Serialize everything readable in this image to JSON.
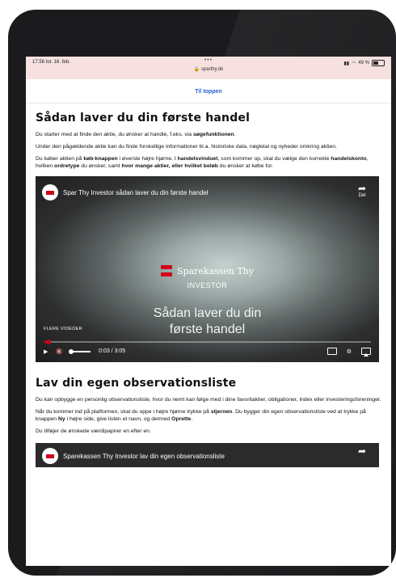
{
  "status": {
    "time_date": "17.56 tor. 16. feb.",
    "dots": "•••",
    "url": "sparthy.dk",
    "battery": "49 %"
  },
  "nav": {
    "to_top": "Til toppen"
  },
  "section1": {
    "heading": "Sådan laver du din første handel",
    "p1_a": "Du starter med at finde den aktie, du ønsker at handle, f.eks. via ",
    "p1_b": "søgefunktionen",
    "p1_c": ".",
    "p2": "Under den pågældende aktie kan du finde forskellige informationer bl.a. historiske data, nøgletal og nyheder omkring aktien.",
    "p3_a": "Du køber aktien på ",
    "p3_b": "køb-knappen",
    "p3_c": " i øverste højre hjørne. I ",
    "p3_d": "handelsvinduet",
    "p3_e": ", som kommer op, skal du vælge den korrekte ",
    "p3_f": "handelskonto",
    "p3_g": ", hvilken ",
    "p3_h": "ordretype",
    "p3_i": " du ønsker, samt ",
    "p3_j": "hvor mange aktier, eller hvilket beløb",
    "p3_k": " du ønsker at købe for."
  },
  "video1": {
    "title": "Spar Thy Investor sådan laver du din første handel",
    "share_label": "Del",
    "brand_name": "Sparekassen Thy",
    "brand_sub": "INVESTOR",
    "overlay_title_line1": "Sådan laver du din",
    "overlay_title_line2": "første handel",
    "more_videos": "FLERE VIDEOER",
    "time": "0:03 / 3:05",
    "progress": 0.016
  },
  "section2": {
    "heading": "Lav din egen observationsliste",
    "p1": "Du kan opbygge en personlig observationsliste, hvor du nemt kan følge med i dine favoritaktier, obligationer, index eller investeringsforeninger.",
    "p2_a": "Når du kommer ind på platformen, skal du oppe i højre hjørne trykke på ",
    "p2_b": "stjernen",
    "p2_c": ". Du bygger din egen observationsliste ved at trykke på knappen ",
    "p2_d": "Ny",
    "p2_e": " i højre side, give listen et navn, og dermed ",
    "p2_f": "Oprette",
    "p2_g": ".",
    "p3": "Du tilføjer de ønskede værdipapirer en efter en."
  },
  "video2": {
    "title": "Sparekassen Thy Investor lav din egen observationsliste"
  },
  "colors": {
    "brand_red": "#d0021b",
    "link_blue": "#2a63c8"
  }
}
